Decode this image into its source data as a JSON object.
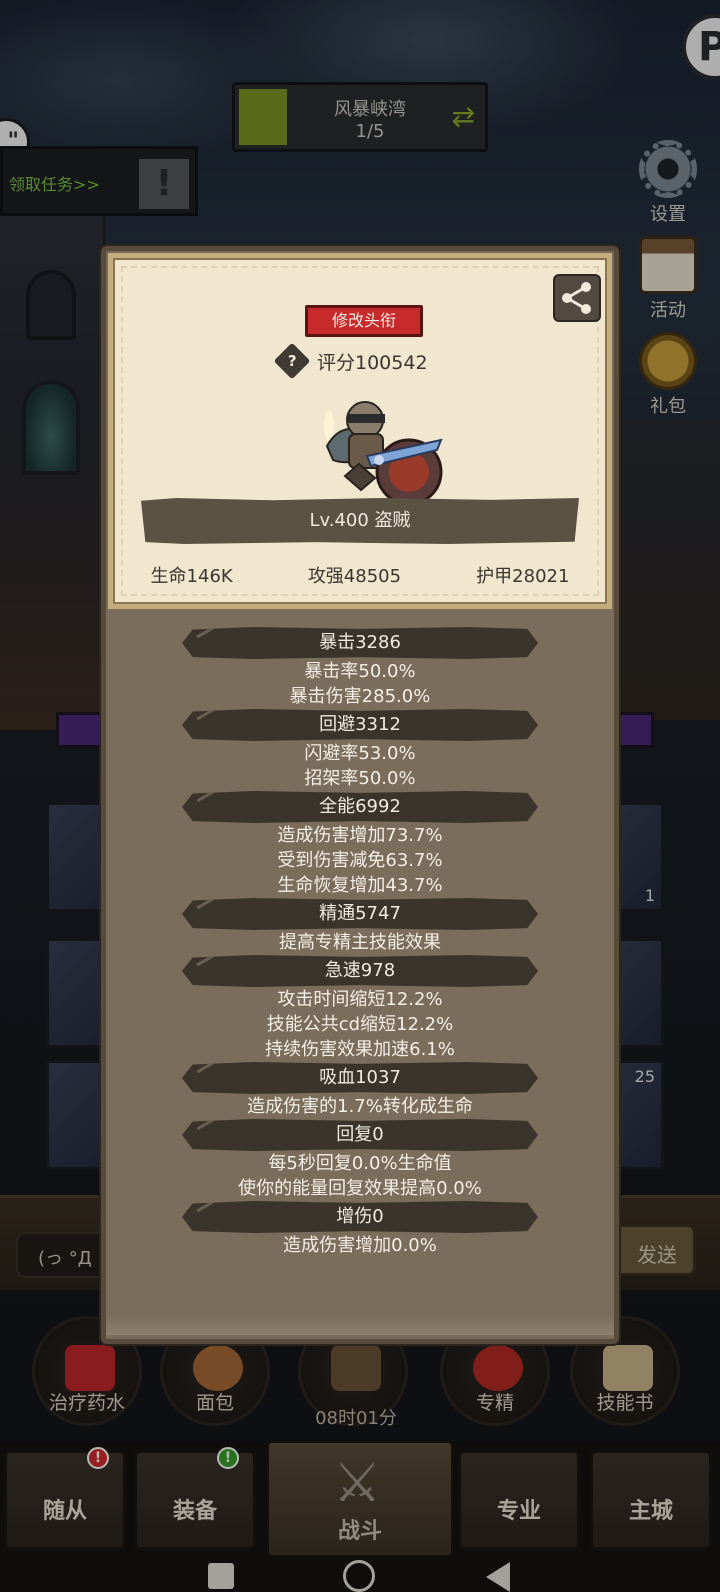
{
  "header": {
    "stage_title": "风暴峡湾",
    "stage_progress": "1/5",
    "quest_text": "领取任务>>"
  },
  "side_buttons": {
    "settings": "设置",
    "events": "活动",
    "gift": "礼包"
  },
  "profile_modal": {
    "title_button": "修改头衔",
    "rating": "评分100542",
    "level_class": "Lv.400 盗贼",
    "basic_stats": {
      "hp": "生命146K",
      "attack_power": "攻强48505",
      "armor": "护甲28021"
    },
    "stat_groups": [
      {
        "header": "暴击3286",
        "details": [
          "暴击率50.0%",
          "暴击伤害285.0%"
        ]
      },
      {
        "header": "回避3312",
        "details": [
          "闪避率53.0%",
          "招架率50.0%"
        ]
      },
      {
        "header": "全能6992",
        "details": [
          "造成伤害增加73.7%",
          "受到伤害减免63.7%",
          "生命恢复增加43.7%"
        ]
      },
      {
        "header": "精通5747",
        "details": [
          "提高专精主技能效果"
        ]
      },
      {
        "header": "急速978",
        "details": [
          "攻击时间缩短12.2%",
          "技能公共cd缩短12.2%",
          "持续伤害效果加速6.1%"
        ]
      },
      {
        "header": "吸血1037",
        "details": [
          "造成伤害的1.7%转化成生命"
        ]
      },
      {
        "header": "回复0",
        "details": [
          "每5秒回复0.0%生命值",
          "使你的能量回复效果提高0.0%"
        ]
      },
      {
        "header": "增伤0",
        "details": [
          "造成伤害增加0.0%"
        ]
      }
    ]
  },
  "background": {
    "chat_input": "(っ °Д °;",
    "send_button": "发送",
    "card_count_1": "1",
    "card_count_2": "25"
  },
  "skills": [
    {
      "label": "治疗药水",
      "icon": "potion-icon",
      "color": "#c0262a"
    },
    {
      "label": "面包",
      "icon": "bread-icon",
      "color": "#a7683a"
    },
    {
      "label": "",
      "icon": "chest-icon",
      "color": "#6a5436"
    },
    {
      "label": "专精",
      "icon": "specialization-icon",
      "color": "#b52a24"
    },
    {
      "label": "技能书",
      "icon": "skillbook-icon",
      "color": "#c9b58a"
    }
  ],
  "timer": "08时01分",
  "bottom_nav": {
    "followers": "随从",
    "equipment": "装备",
    "battle": "战斗",
    "profession": "专业",
    "main_city": "主城",
    "badge_followers": "!",
    "badge_equipment": "!"
  },
  "colors": {
    "modal_bg": "#7a6d5b",
    "card_bg": "#f1e7cf",
    "title_button": "#c72a2a",
    "stat_header_bg": "#3b342c",
    "quest_green": "#7bc142"
  }
}
